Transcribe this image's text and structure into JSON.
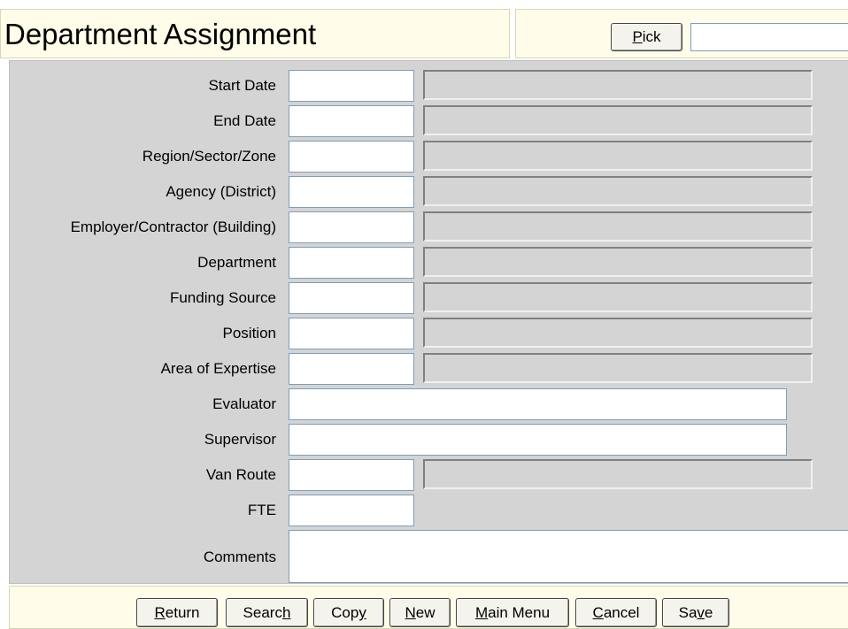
{
  "header": {
    "title": "Department Assignment",
    "pick_label": "Pick",
    "pick_accesskey": "P",
    "pick_value": ""
  },
  "fields": [
    {
      "label": "Start Date",
      "code": "",
      "description": ""
    },
    {
      "label": "End Date",
      "code": "",
      "description": ""
    },
    {
      "label": "Region/Sector/Zone",
      "code": "",
      "description": ""
    },
    {
      "label": "Agency (District)",
      "code": "",
      "description": ""
    },
    {
      "label": "Employer/Contractor (Building)",
      "code": "",
      "description": ""
    },
    {
      "label": "Department",
      "code": "",
      "description": ""
    },
    {
      "label": "Funding Source",
      "code": "",
      "description": ""
    },
    {
      "label": "Position",
      "code": "",
      "description": ""
    },
    {
      "label": "Area of Expertise",
      "code": "",
      "description": ""
    },
    {
      "label": "Evaluator",
      "value": ""
    },
    {
      "label": "Supervisor",
      "value": ""
    },
    {
      "label": "Van Route",
      "code": "",
      "description": ""
    },
    {
      "label": "FTE",
      "value": ""
    },
    {
      "label": "Comments",
      "value": ""
    }
  ],
  "buttons": [
    {
      "label": "Return",
      "accesskey": "R"
    },
    {
      "label": "Search",
      "accesskey": "h"
    },
    {
      "label": "Copy",
      "accesskey": "y"
    },
    {
      "label": "New",
      "accesskey": "N"
    },
    {
      "label": "Main Menu",
      "accesskey": "M"
    },
    {
      "label": "Cancel",
      "accesskey": "C"
    },
    {
      "label": "Save",
      "accesskey": "v"
    }
  ],
  "colors": {
    "header_bg": "#fffde9",
    "form_bg": "#d4d4d4",
    "input_border": "#7f9db9"
  }
}
